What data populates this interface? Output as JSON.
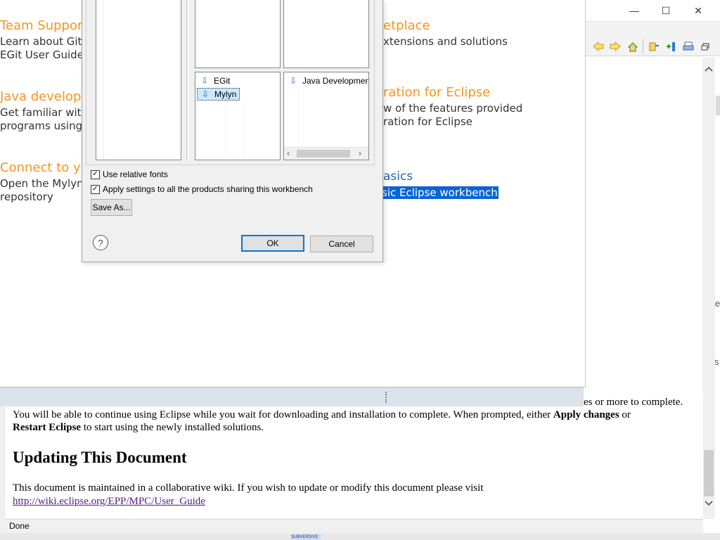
{
  "help_window": {
    "window_controls": {
      "minimize": "—",
      "maximize": "☐",
      "close": "✕"
    },
    "clipped_text_1": "ie",
    "clipped_text_2": "s"
  },
  "welcome": {
    "team_support": {
      "title": "Team Suppor",
      "line1": "Learn about Git",
      "line2": "EGit User Guide"
    },
    "java_dev": {
      "title": "Java develop",
      "line1": "Get familiar wit",
      "line2": "programs using"
    },
    "connect": {
      "title": "Connect to y",
      "line1": "Open the Mylyn",
      "line2": "repository"
    },
    "marketplace": {
      "title": "etplace",
      "line1": "xtensions and solutions"
    },
    "integration": {
      "title": "ration for Eclipse",
      "line1": "w of the features provided",
      "line2": "ration for Eclipse"
    },
    "basics": {
      "title": "asics",
      "selected": "sic Eclipse workbench"
    }
  },
  "dialog": {
    "list_middle_items": [
      {
        "label": "EGit",
        "icon": "download-arrow-icon"
      },
      {
        "label": "Mylyn",
        "icon": "download-arrow-icon",
        "selected": true
      }
    ],
    "list_right_items": [
      {
        "label": "Java Developmen",
        "icon": "download-arrow-icon"
      }
    ],
    "use_relative_fonts": {
      "label": "Use relative fonts",
      "checked": true
    },
    "apply_settings": {
      "label": "Apply settings to all the products sharing this workbench",
      "checked": true
    },
    "save_as_label": "Save As...",
    "ok_label": "OK",
    "cancel_label": "Cancel",
    "help_glyph": "?"
  },
  "document": {
    "para_line0": "es or more to complete.",
    "para_line1_a": "You will be able to continue using Eclipse while you wait for downloading and installation to complete. When prompted, either ",
    "para_line1_b": "Apply changes",
    "para_line1_c": " or",
    "para_line2_a": "Restart Eclipse",
    "para_line2_b": " to start using the newly installed solutions.",
    "heading": "Updating This Document",
    "para2": "This document is maintained in a collaborative wiki. If you wish to update or modify this document please visit",
    "link": "http://wiki.eclipse.org/EPP/MPC/User_Guide"
  },
  "status_text": "Done",
  "taskbar_label": "SUBVERSIVE",
  "colors": {
    "accent_orange": "#f7941e",
    "selection_blue": "#0a64d7",
    "link_purple": "#551a8b"
  }
}
